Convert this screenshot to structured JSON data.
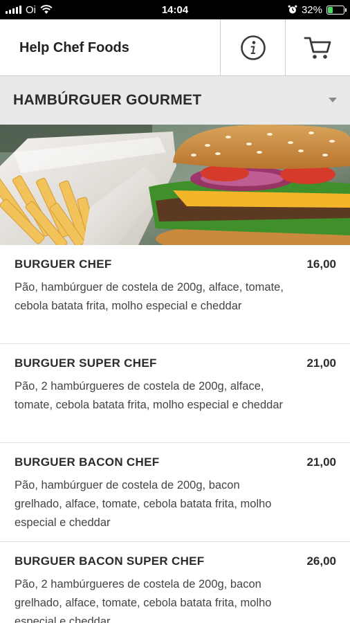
{
  "status_bar": {
    "carrier": "Oi",
    "time": "14:04",
    "battery_percent": "32%",
    "battery_level": 0.32,
    "battery_color": "#4cd964"
  },
  "header": {
    "title": "Help Chef Foods",
    "info_icon": "info-circle-icon",
    "cart_icon": "shopping-cart-icon"
  },
  "category": {
    "selected": "HAMBÚRGUER GOURMET"
  },
  "menu": {
    "items": [
      {
        "name": "BURGUER CHEF",
        "price": "16,00",
        "description": "Pão, hambúrguer de costela de 200g, alface, tomate, cebola batata frita, molho especial e cheddar"
      },
      {
        "name": "BURGUER SUPER CHEF",
        "price": "21,00",
        "description": "Pão, 2 hambúrgueres de costela de 200g, alface, tomate, cebola batata frita, molho especial e cheddar"
      },
      {
        "name": "BURGUER BACON CHEF",
        "price": "21,00",
        "description": "Pão, hambúrguer de costela de 200g, bacon grelhado, alface, tomate, cebola batata frita, molho especial e cheddar"
      },
      {
        "name": "BURGUER BACON SUPER CHEF",
        "price": "26,00",
        "description": "Pão, 2 hambúrgueres de costela de 200g, bacon grelhado, alface, tomate, cebola batata frita, molho especial e cheddar"
      }
    ]
  }
}
